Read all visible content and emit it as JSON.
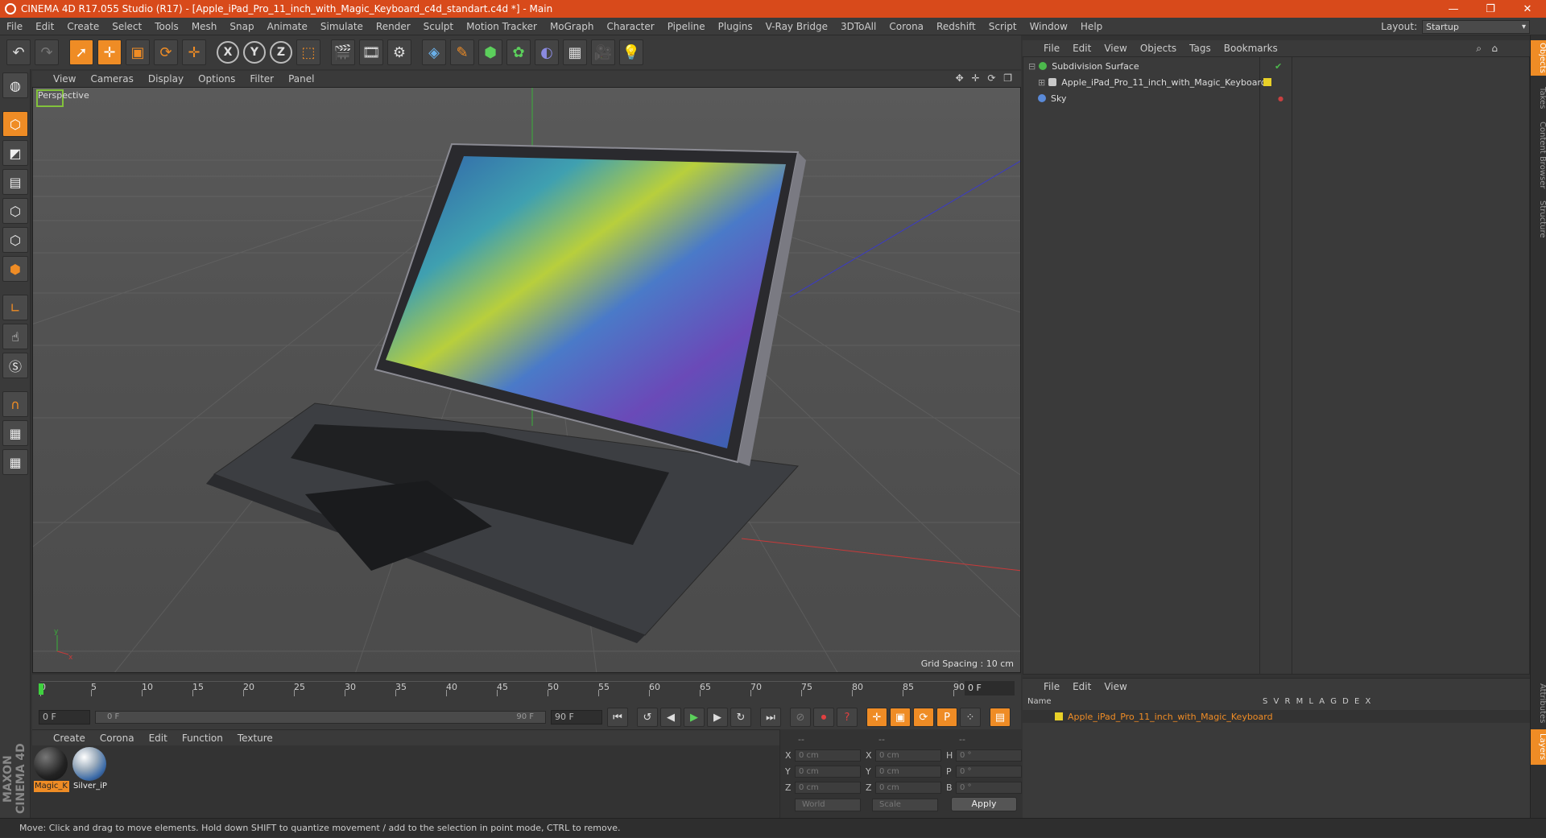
{
  "window": {
    "title": "CINEMA 4D R17.055 Studio (R17) - [Apple_iPad_Pro_11_inch_with_Magic_Keyboard_c4d_standart.c4d *] - Main",
    "minimize": "—",
    "restore": "❐",
    "close": "✕"
  },
  "menu": [
    "File",
    "Edit",
    "Create",
    "Select",
    "Tools",
    "Mesh",
    "Snap",
    "Animate",
    "Simulate",
    "Render",
    "Sculpt",
    "Motion Tracker",
    "MoGraph",
    "Character",
    "Pipeline",
    "Plugins",
    "V-Ray Bridge",
    "3DToAll",
    "Corona",
    "Redshift",
    "Script",
    "Window",
    "Help"
  ],
  "layout": {
    "label": "Layout:",
    "value": "Startup"
  },
  "viewport": {
    "menu": [
      "View",
      "Cameras",
      "Display",
      "Options",
      "Filter",
      "Panel"
    ],
    "nav_icons": "✥ ✛ ⟳ ❐",
    "camera_label": "Perspective",
    "grid_spacing": "Grid Spacing : 10 cm"
  },
  "timeline": {
    "ticks": [
      "0",
      "5",
      "10",
      "15",
      "20",
      "25",
      "30",
      "35",
      "40",
      "45",
      "50",
      "55",
      "60",
      "65",
      "70",
      "75",
      "80",
      "85",
      "90"
    ],
    "current_frame": "0 F"
  },
  "transport": {
    "start": "0 F",
    "range_start": "0 F",
    "range_end": "90 F",
    "end": "90 F"
  },
  "materials": {
    "menu": [
      "Create",
      "Corona",
      "Edit",
      "Function",
      "Texture"
    ],
    "items": [
      {
        "name": "Magic_K"
      },
      {
        "name": "Silver_iP"
      }
    ]
  },
  "coords": {
    "header": [
      "--",
      "--",
      "--"
    ],
    "rows": [
      {
        "a": "X",
        "av": "0 cm",
        "b": "X",
        "bv": "0 cm",
        "c": "H",
        "cv": "0 °"
      },
      {
        "a": "Y",
        "av": "0 cm",
        "b": "Y",
        "bv": "0 cm",
        "c": "P",
        "cv": "0 °"
      },
      {
        "a": "Z",
        "av": "0 cm",
        "b": "Z",
        "bv": "0 cm",
        "c": "B",
        "cv": "0 °"
      }
    ],
    "space": "World",
    "mode": "Scale",
    "apply": "Apply"
  },
  "objects": {
    "menu": [
      "File",
      "Edit",
      "View",
      "Objects",
      "Tags",
      "Bookmarks"
    ],
    "items": [
      {
        "name": "Subdivision Surface",
        "color": "#4cb84c"
      },
      {
        "name": "Apple_iPad_Pro_11_inch_with_Magic_Keyboard",
        "color": "#c8c8c8"
      },
      {
        "name": "Sky",
        "color": "#5a8ad8"
      }
    ]
  },
  "layers": {
    "menu": [
      "File",
      "Edit",
      "View"
    ],
    "header_name": "Name",
    "header_cols": "S V R M L A G D E X",
    "row": "Apple_iPad_Pro_11_inch_with_Magic_Keyboard"
  },
  "side_tabs": [
    "Objects",
    "Takes",
    "Content Browser",
    "Structure",
    "Attributes",
    "Layers"
  ],
  "status": "Move: Click and drag to move elements. Hold down SHIFT to quantize movement / add to the selection in point mode, CTRL to remove.",
  "colors": {
    "accent": "#ef8c25",
    "titlebar": "#d84a1b"
  }
}
